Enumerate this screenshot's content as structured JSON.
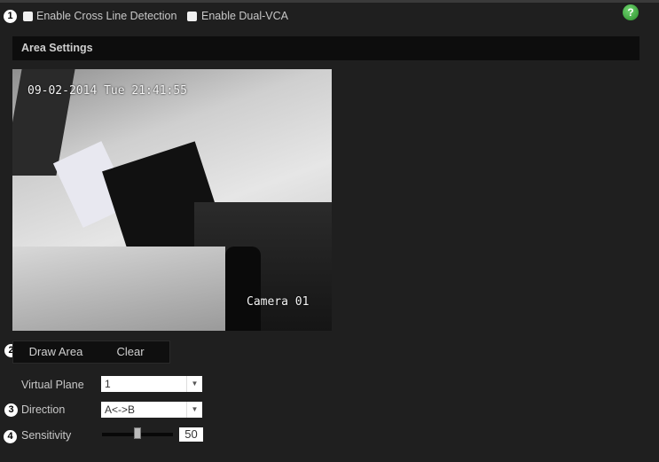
{
  "header": {
    "enable_cross_line_label": "Enable Cross Line Detection",
    "enable_cross_line_checked": false,
    "enable_dual_vca_label": "Enable Dual-VCA",
    "enable_dual_vca_checked": false,
    "help_icon": "?"
  },
  "callouts": [
    "1",
    "2",
    "3",
    "4"
  ],
  "area_settings": {
    "title": "Area Settings"
  },
  "video": {
    "timestamp": "09-02-2014 Tue 21:41:55",
    "camera_name": "Camera 01"
  },
  "buttons": {
    "draw_area": "Draw Area",
    "clear": "Clear"
  },
  "form": {
    "virtual_plane_label": "Virtual Plane",
    "virtual_plane_value": "1",
    "direction_label": "Direction",
    "direction_value": "A<->B",
    "sensitivity_label": "Sensitivity",
    "sensitivity_value": "50",
    "sensitivity_fraction": 0.5
  },
  "colors": {
    "background": "#1f1f1f",
    "help": "#3aa63a"
  }
}
